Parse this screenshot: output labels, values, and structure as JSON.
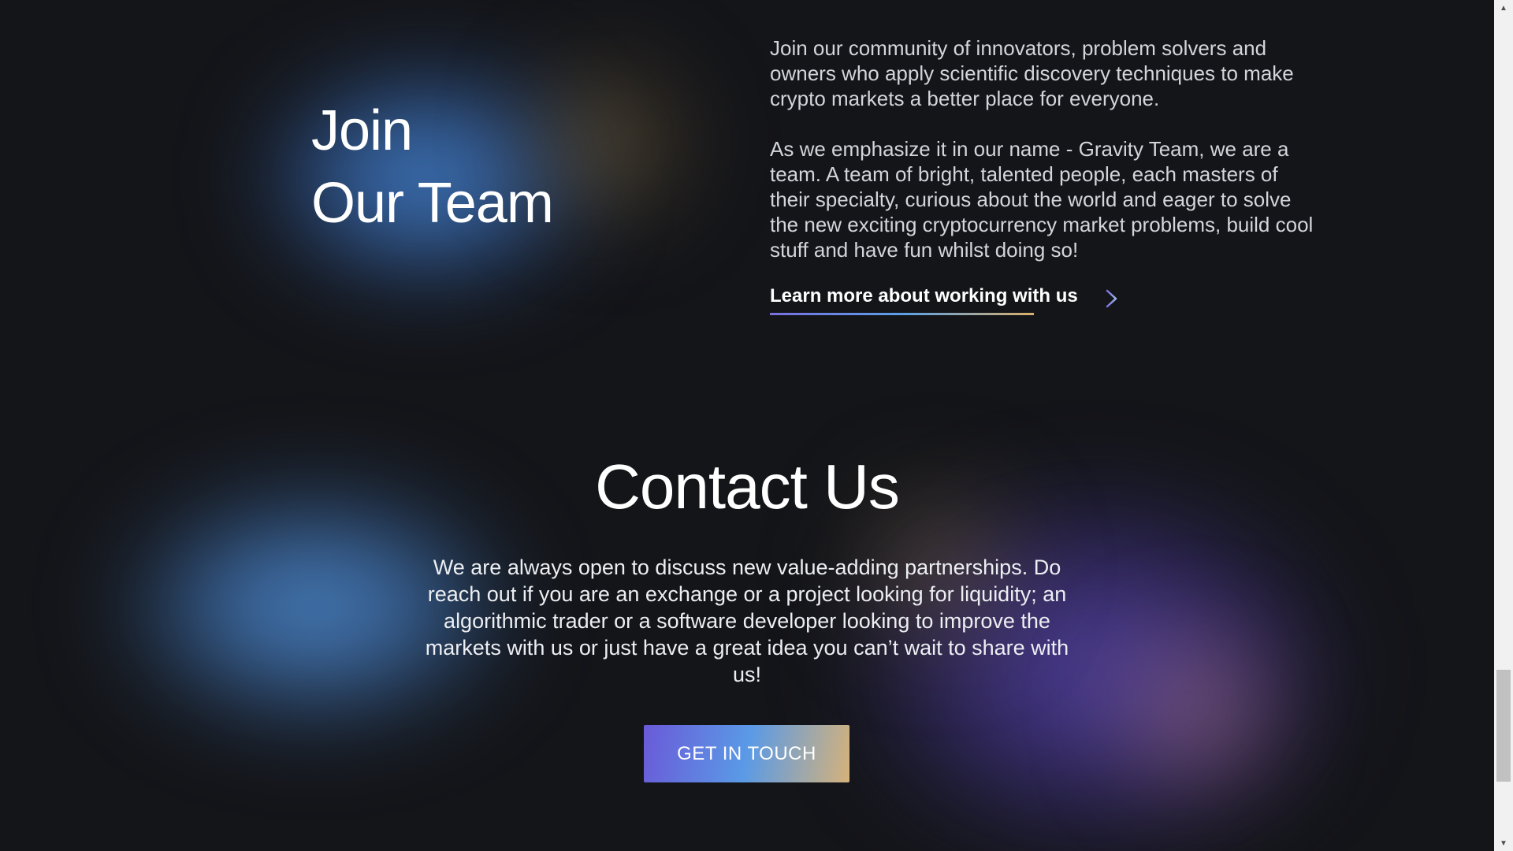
{
  "join": {
    "title_line1": "Join",
    "title_line2": "Our Team",
    "paragraph1": "Join our community of innovators, problem solvers and owners who apply scientific discovery techniques to make crypto markets a better place for everyone.",
    "paragraph2": "As we emphasize it in our name - Gravity Team, we are a team. A team of bright, talented people, each masters of their specialty, curious about the world and eager to solve the new exciting cryptocurrency market problems, build cool stuff and have fun whilst doing so!",
    "link_label": "Learn more about working with us",
    "link_icon": "arrow-right-icon"
  },
  "contact": {
    "title": "Contact Us",
    "text": "We are always open to discuss new value-adding partnerships. Do reach out if you are an exchange or a project looking for liquidity; an algorithmic trader or a software developer looking to improve the markets with us or just have a great idea you can’t wait to share with us!",
    "button_label": "GET IN TOUCH"
  },
  "colors": {
    "background": "#141519",
    "gradient_purple": "#6a5ad8",
    "gradient_blue": "#5a9ae6",
    "gradient_gold": "#d5b27a"
  },
  "scrollbar": {
    "up_icon": "triangle-up-icon",
    "down_icon": "triangle-down-icon"
  }
}
